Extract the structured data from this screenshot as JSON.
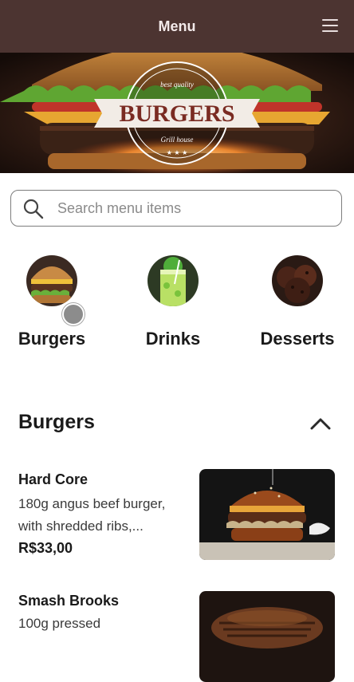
{
  "header": {
    "title": "Menu",
    "menu_icon": "hamburger-menu-icon"
  },
  "hero": {
    "badge_top": "best quality",
    "badge_title": "BURGERS",
    "badge_bottom": "Grill house"
  },
  "search": {
    "placeholder": "Search menu items",
    "value": "",
    "icon": "search-icon"
  },
  "categories": [
    {
      "label": "Burgers"
    },
    {
      "label": "Drinks"
    },
    {
      "label": "Desserts"
    }
  ],
  "section": {
    "title": "Burgers",
    "toggle_icon": "chevron-up-icon"
  },
  "items": [
    {
      "name": "Hard Core",
      "description_line1": "180g angus beef burger,",
      "description_line2": "with shredded ribs,...",
      "price": "R$33,00"
    },
    {
      "name": "Smash Brooks",
      "description_line1": "100g pressed",
      "description_line2": "",
      "price": ""
    }
  ],
  "colors": {
    "header_bg": "#4c3431",
    "header_text": "#f3eaea"
  }
}
